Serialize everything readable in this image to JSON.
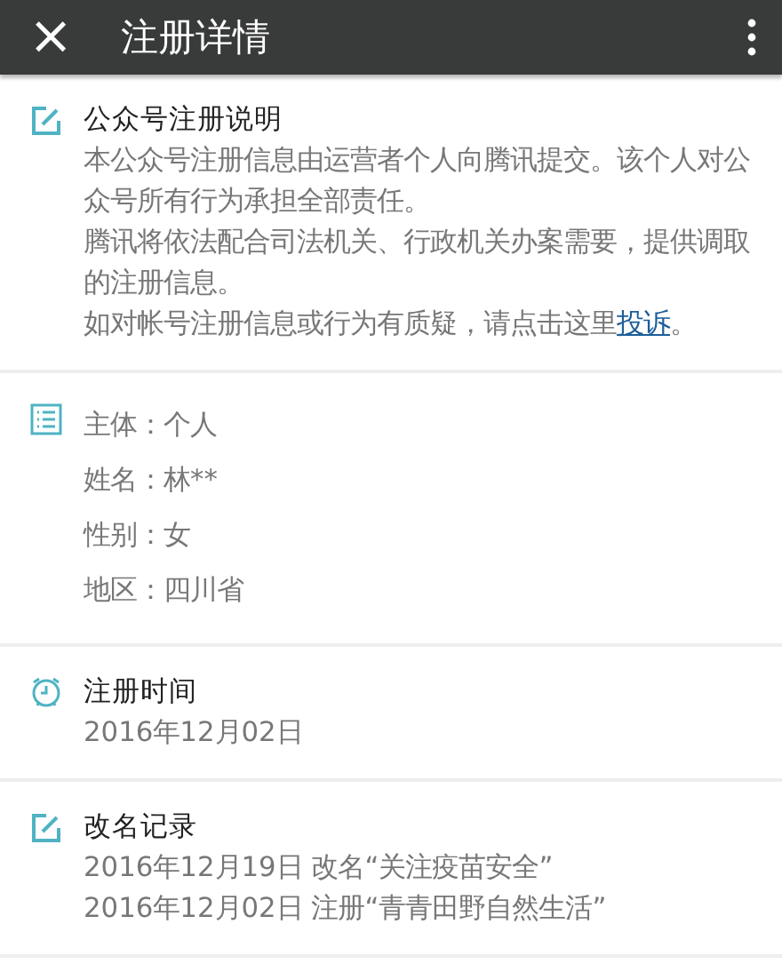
{
  "app_bar": {
    "close_icon": "×",
    "title": "注册详情"
  },
  "sections": [
    {
      "kind": "edit",
      "title": "公众号注册说明",
      "lines": [
        {
          "text": "本公众号注册信息由运营者个人向腾讯提交。该个人对公众号所有行为承担全部责任。"
        },
        {
          "text": "腾讯将依法配合司法机关、行政机关办案需要，提供调取的注册信息。"
        },
        {
          "text": "如对帐号注册信息或行为有质疑，请点击这里",
          "link": "投诉",
          "after": "。"
        }
      ]
    },
    {
      "kind": "list",
      "lines": [
        {
          "text": "主体：个人"
        },
        {
          "text": "姓名：林**"
        },
        {
          "text": "性别：女"
        },
        {
          "text": "地区：四川省"
        }
      ]
    },
    {
      "kind": "clock",
      "title": "注册时间",
      "lines": [
        {
          "text": "2016年12月02日"
        }
      ]
    },
    {
      "kind": "edit",
      "title": "改名记录",
      "lines": [
        {
          "text": "2016年12月19日 改名“关注疫苗安全”"
        },
        {
          "text": "2016年12月02日 注册“青青田野自然生活”"
        }
      ]
    }
  ]
}
